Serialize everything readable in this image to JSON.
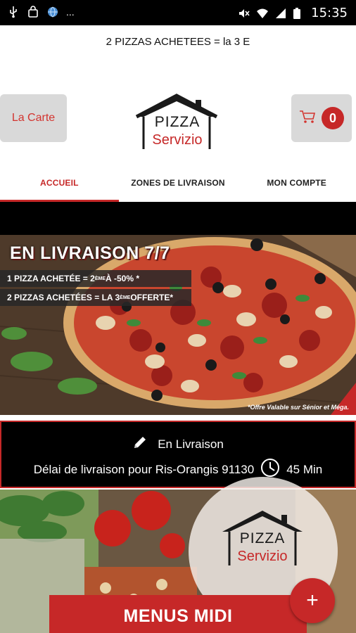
{
  "status_bar": {
    "time": "15:35",
    "left_icons": [
      "usb-icon",
      "bag-icon",
      "globe-icon",
      "more-icon"
    ],
    "more_label": "...",
    "right_icons": [
      "mute-icon",
      "wifi-icon",
      "signal-icon",
      "battery-icon"
    ]
  },
  "ticker": {
    "text": "2 PIZZAS ACHETEES = la 3 E"
  },
  "header": {
    "carte_label": "La Carte",
    "cart_count": "0",
    "logo_word1": "PIZZA",
    "logo_word2": "Servizio"
  },
  "tabs": [
    {
      "label": "ACCUEIL",
      "active": true
    },
    {
      "label": "ZONES DE LIVRAISON",
      "active": false
    },
    {
      "label": "MON COMPTE",
      "active": false
    }
  ],
  "promo": {
    "title": "EN LIVRAISON 7/7",
    "line1_a": "1 PIZZA ACHETÉE = 2",
    "line1_sup": "ÈME",
    "line1_b": " À -50% *",
    "line2_a": "2 PIZZAS ACHETÉES = LA 3",
    "line2_sup": "ÈME",
    "line2_b": " OFFERTE*",
    "note": "*Offre Valable sur Sénior et Méga."
  },
  "delivery": {
    "mode": "En Livraison",
    "delay_text": "Délai de livraison pour Ris-Orangis 91130",
    "delay_time": "45 Min"
  },
  "bottom": {
    "menus_label": "MENUS MIDI",
    "fab_label": "+"
  },
  "colors": {
    "accent": "#c62828",
    "button_gray": "#d9d9d9",
    "band": "#000000"
  }
}
